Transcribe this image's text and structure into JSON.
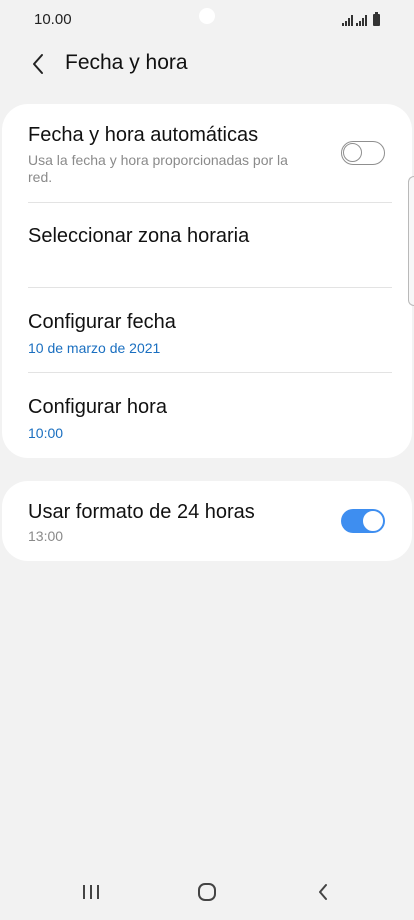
{
  "status_bar": {
    "time": "10.00",
    "icons": [
      "signal-icon",
      "signal-icon",
      "battery-icon"
    ]
  },
  "header": {
    "back_icon": "chevron-left-icon",
    "title": "Fecha y hora"
  },
  "settings_group_1": {
    "auto_datetime": {
      "title": "Fecha y hora automáticas",
      "subtitle_line1": "Usa la fecha y hora proporcionadas por la",
      "subtitle_line2": "red.",
      "enabled": false
    },
    "timezone": {
      "title": "Seleccionar zona horaria"
    },
    "set_date": {
      "title": "Configurar fecha",
      "value": "10 de marzo de 2021"
    },
    "set_time": {
      "title": "Configurar hora",
      "value": "10:00"
    }
  },
  "settings_group_2": {
    "use_24h": {
      "title": "Usar formato de 24 horas",
      "subtitle": "13:00",
      "enabled": true
    }
  },
  "navigation_bar": {
    "recents_icon": "recents-icon",
    "home_icon": "home-icon",
    "back_icon": "back-icon"
  },
  "colors": {
    "accent": "#3e8ef0",
    "value_text": "#1a6fc0",
    "background": "#f2f2f2",
    "card": "#ffffff"
  }
}
